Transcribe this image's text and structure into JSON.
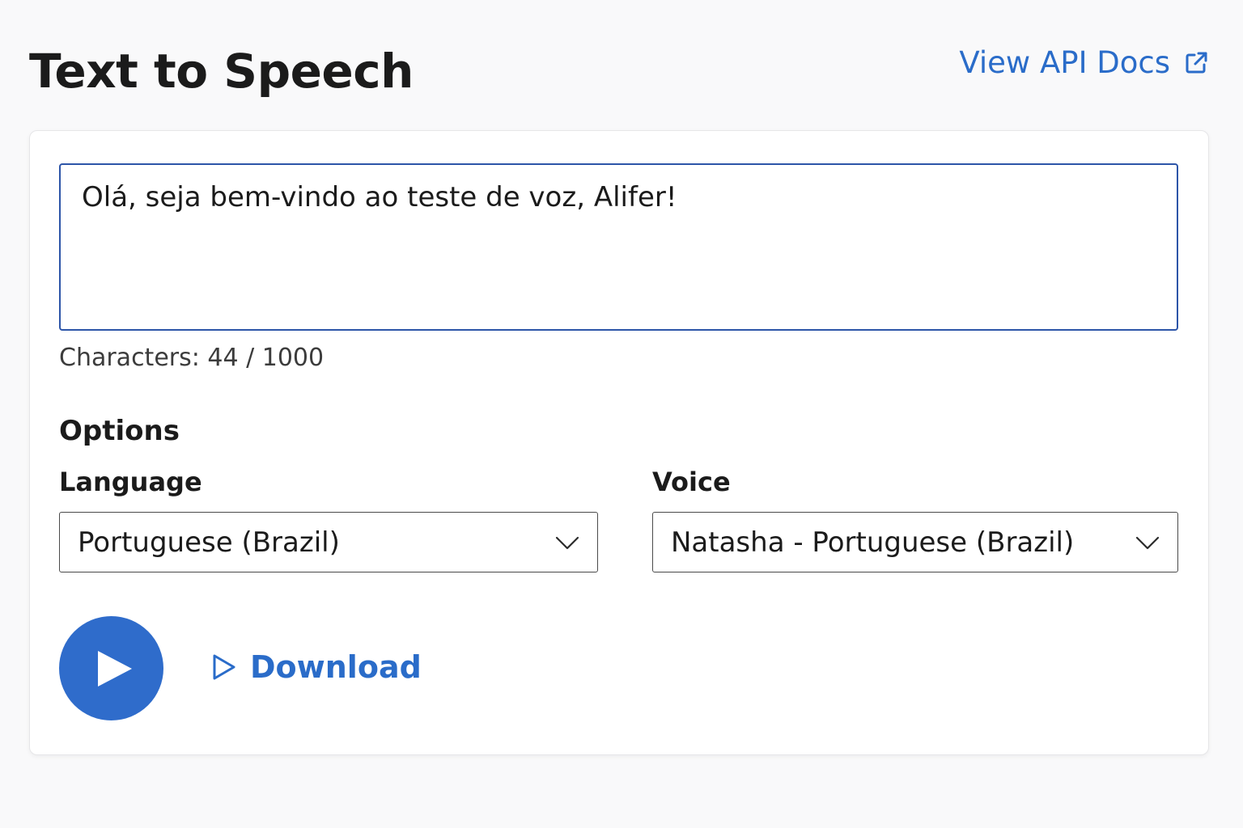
{
  "header": {
    "title": "Text to Speech",
    "api_link_label": "View API Docs",
    "api_link_icon": "external-link-icon"
  },
  "input": {
    "text": "Olá, seja bem-vindo ao teste de voz, Alifer!",
    "char_count_label": "Characters: 44 / 1000"
  },
  "options": {
    "heading": "Options",
    "language": {
      "label": "Language",
      "selected": "Portuguese (Brazil)"
    },
    "voice": {
      "label": "Voice",
      "selected": "Natasha - Portuguese (Brazil)"
    }
  },
  "actions": {
    "play_icon": "play-icon",
    "download_label": "Download",
    "download_icon": "play-outline-icon"
  },
  "colors": {
    "accent": "#2a6cc9",
    "play_button": "#2f6ccb",
    "input_border": "#2d55a8"
  }
}
